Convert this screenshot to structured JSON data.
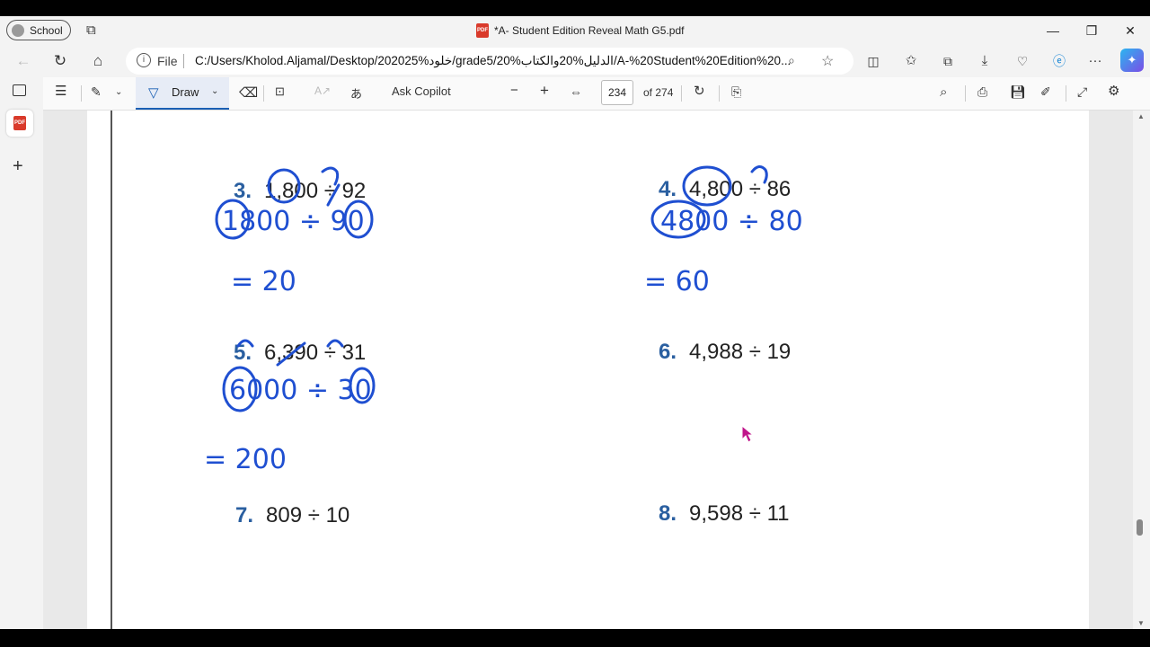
{
  "titlebar": {
    "profile": "School",
    "tab_title": "*A- Student Edition Reveal Math G5.pdf",
    "minimize": "—",
    "restore": "❐",
    "close": "✕"
  },
  "address": {
    "file_label": "File",
    "url": "C:/Users/Kholod.Aljamal/Desktop/202025%خلود/grade5/الدليل%20والكتاب%20/A-%20Student%20Edition%20..."
  },
  "pdf_toolbar": {
    "draw_label": "Draw",
    "ask_copilot": "Ask Copilot",
    "page_current": "234",
    "page_total": "of 274",
    "zoom_out": "−",
    "zoom_in": "+"
  },
  "problems": [
    {
      "num": "3.",
      "expr": "1,800 ÷ 92"
    },
    {
      "num": "4.",
      "expr": "4,800 ÷ 86"
    },
    {
      "num": "5.",
      "expr": "6,390 ÷ 31"
    },
    {
      "num": "6.",
      "expr": "4,988 ÷ 19"
    },
    {
      "num": "7.",
      "expr": "809 ÷ 10"
    },
    {
      "num": "8.",
      "expr": "9,598 ÷ 11"
    }
  ],
  "handwriting": {
    "p3_line1": "1800 ÷ 90",
    "p3_line2": "= 20",
    "p4_line1": "4800 ÷ 80",
    "p4_line2": "= 60",
    "p5_line1": "6000 ÷ 30",
    "p5_line2": "= 200"
  },
  "colors": {
    "ink": "#1f4fd1",
    "number": "#2a5fa0",
    "cursor": "#c0158a"
  }
}
